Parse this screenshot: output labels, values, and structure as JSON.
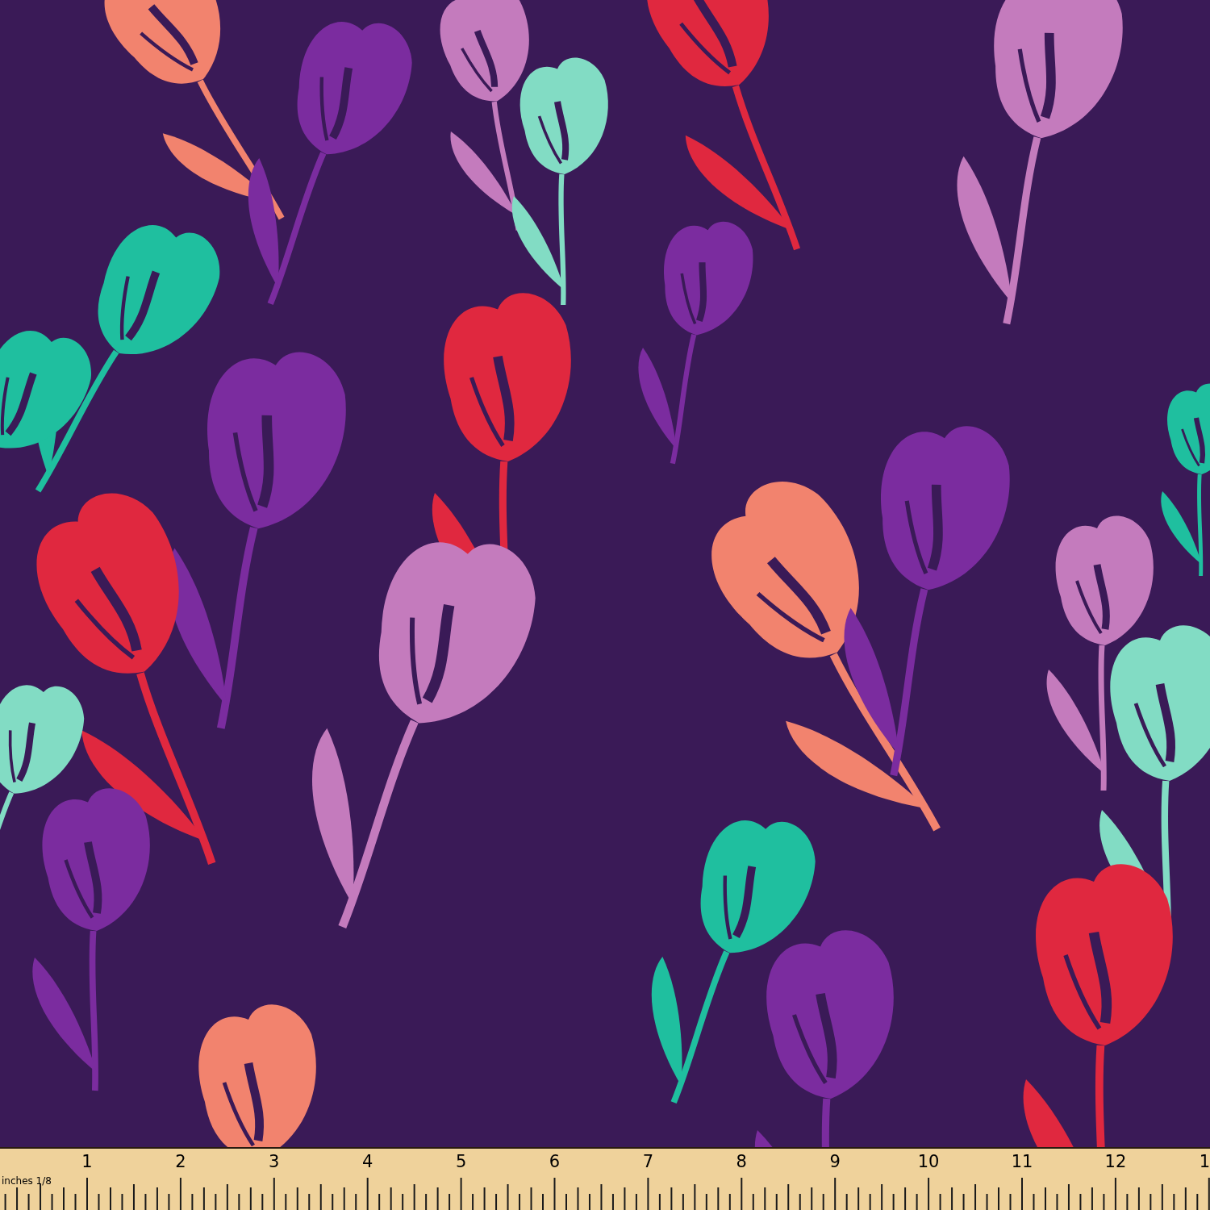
{
  "ruler": {
    "unit_label": "inches 1/8",
    "numbers": [
      "1",
      "2",
      "3",
      "4",
      "5",
      "6",
      "7",
      "8",
      "9",
      "10",
      "11",
      "12",
      "1"
    ]
  }
}
